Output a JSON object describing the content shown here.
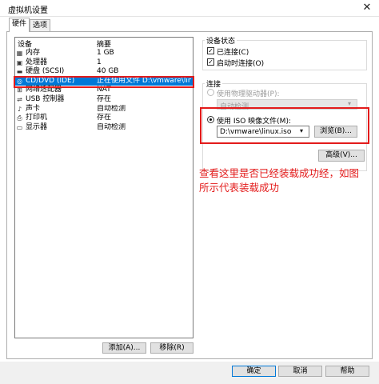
{
  "window": {
    "title": "虚拟机设置",
    "close_glyph": "✕"
  },
  "tabs": [
    "硬件",
    "选项"
  ],
  "device_list": {
    "col_device": "设备",
    "col_summary": "摘要",
    "rows": [
      {
        "icon": "memory-icon",
        "glyph": "▦",
        "name": "内存",
        "summary": "1 GB"
      },
      {
        "icon": "processor-icon",
        "glyph": "▣",
        "name": "处理器",
        "summary": "1"
      },
      {
        "icon": "hard-disk-icon",
        "glyph": "▬",
        "name": "硬盘 (SCSI)",
        "summary": "40 GB"
      },
      {
        "icon": "cd-dvd-icon",
        "glyph": "◎",
        "name": "CD/DVD (IDE)",
        "summary": "正在使用文件 D:\\vmware\\linux...",
        "selected": true
      },
      {
        "icon": "network-adapter-icon",
        "glyph": "⊞",
        "name": "网络适配器",
        "summary": "NAT"
      },
      {
        "icon": "usb-controller-icon",
        "glyph": "⇌",
        "name": "USB 控制器",
        "summary": "存在"
      },
      {
        "icon": "sound-card-icon",
        "glyph": "♪",
        "name": "声卡",
        "summary": "自动检测"
      },
      {
        "icon": "printer-icon",
        "glyph": "⎙",
        "name": "打印机",
        "summary": "存在"
      },
      {
        "icon": "display-icon",
        "glyph": "▭",
        "name": "显示器",
        "summary": "自动检测"
      }
    ],
    "add_button": "添加(A)...",
    "remove_button": "移除(R)"
  },
  "device_status": {
    "label": "设备状态",
    "connected": {
      "label": "已连接(C)",
      "checked": true
    },
    "connect_on_power_on": {
      "label": "启动时连接(O)",
      "checked": true
    }
  },
  "connection": {
    "label": "连接",
    "physical_drive": {
      "label": "使用物理驱动器(P):",
      "dropdown_value": "自动检测",
      "selected": false
    },
    "iso_file": {
      "label": "使用 ISO 映像文件(M):",
      "path": "D:\\vmware\\linux.iso",
      "selected": true
    },
    "browse_button": "浏览(B)...",
    "advanced_button": "高级(V)..."
  },
  "annotation": "查看这里是否已经装载成功经，如图\n所示代表装载成功",
  "footer": {
    "ok": "确定",
    "cancel": "取消",
    "help": "帮助"
  },
  "colors": {
    "selection": "#0078d7",
    "annotation_red": "#e31b1b"
  }
}
